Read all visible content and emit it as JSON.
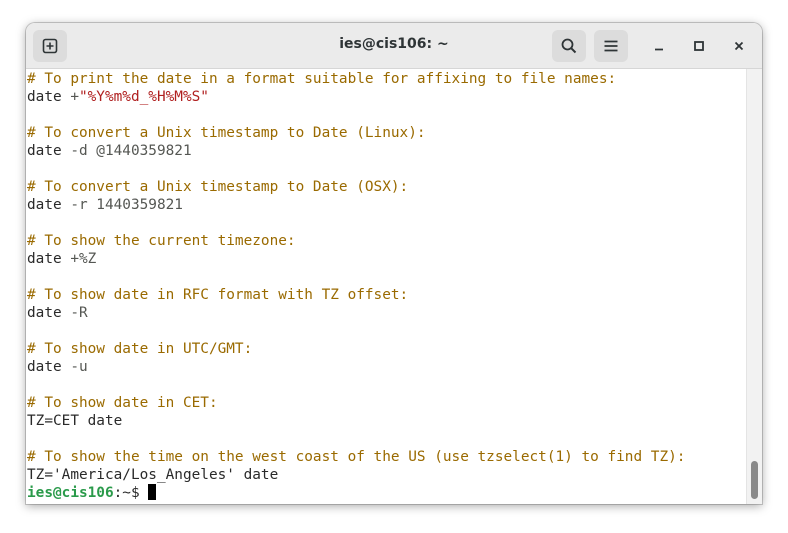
{
  "window": {
    "title": "ies@cis106: ~",
    "icons": {
      "new_tab": "new-tab-icon",
      "search": "search-icon",
      "menu": "hamburger-menu-icon",
      "minimize": "minimize-icon",
      "maximize": "maximize-icon",
      "close": "close-icon"
    }
  },
  "terminal": {
    "lines": [
      {
        "comment": "# To print the date in a format suitable for affixing to file names:"
      },
      {
        "cmd": "date",
        "arg": " +",
        "str": "\"%Y%m%d_%H%M%S\""
      },
      {
        "blank": ""
      },
      {
        "comment": "# To convert a Unix timestamp to Date (Linux):"
      },
      {
        "cmd": "date",
        "arg": " -d @1440359821"
      },
      {
        "blank": ""
      },
      {
        "comment": "# To convert a Unix timestamp to Date (OSX):"
      },
      {
        "cmd": "date",
        "arg": " -r 1440359821"
      },
      {
        "blank": ""
      },
      {
        "comment": "# To show the current timezone:"
      },
      {
        "cmd": "date",
        "arg": " +%Z"
      },
      {
        "blank": ""
      },
      {
        "comment": "# To show date in RFC format with TZ offset:"
      },
      {
        "cmd": "date",
        "arg": " -R"
      },
      {
        "blank": ""
      },
      {
        "comment": "# To show date in UTC/GMT:"
      },
      {
        "cmd": "date",
        "arg": " -u"
      },
      {
        "blank": ""
      },
      {
        "comment": "# To show date in CET:"
      },
      {
        "cmd": "TZ=CET date"
      },
      {
        "blank": ""
      },
      {
        "comment": "# To show the time on the west coast of the US (use tzselect(1) to find TZ):"
      },
      {
        "cmd": "TZ='America/Los_Angeles' date"
      }
    ],
    "prompt": {
      "user_host": "ies@cis106",
      "path_symbol": ":~$ "
    }
  },
  "colors": {
    "comment": "#9a6a00",
    "string": "#b02020",
    "prompt": "#2a9a4a",
    "titlebar": "#ebebeb"
  }
}
